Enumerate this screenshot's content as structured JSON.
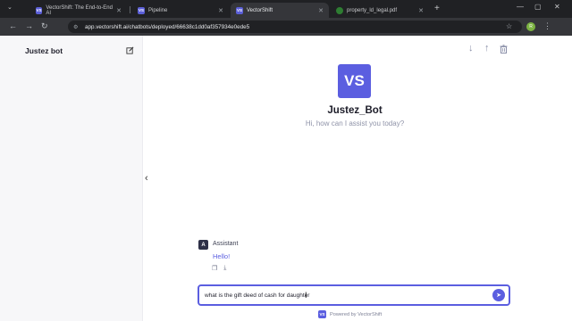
{
  "browser": {
    "tabs": [
      {
        "label": "VectorShift: The End-to-End AI",
        "favicon": "VS",
        "active": false
      },
      {
        "label": "Pipeline",
        "favicon": "VS",
        "active": false
      },
      {
        "label": "VectorShift",
        "favicon": "VS",
        "active": true
      },
      {
        "label": "property_ld_legal.pdf",
        "favicon": "drive-icon",
        "active": false
      }
    ],
    "url": "app.vectorshift.ai/chatbots/deployed/66638c1dd0af357934e0ede5",
    "profile_initial": "R"
  },
  "sidebar": {
    "title": "Justez bot"
  },
  "chat": {
    "logo_text": "VS",
    "bot_name": "Justez_Bot",
    "greeting": "Hi, how can I assist you today?",
    "messages": [
      {
        "role": "Assistant",
        "avatar": "A",
        "text": "Hello!"
      }
    ],
    "input_value": "what is the gift deed of cash for daughter",
    "powered_by": "Powered by VectorShift",
    "powered_logo": "VS"
  },
  "colors": {
    "accent": "#5b5ee0",
    "tab_bar": "#202124",
    "address_bar": "#35363a",
    "sidebar_bg": "#f7f7f9"
  }
}
